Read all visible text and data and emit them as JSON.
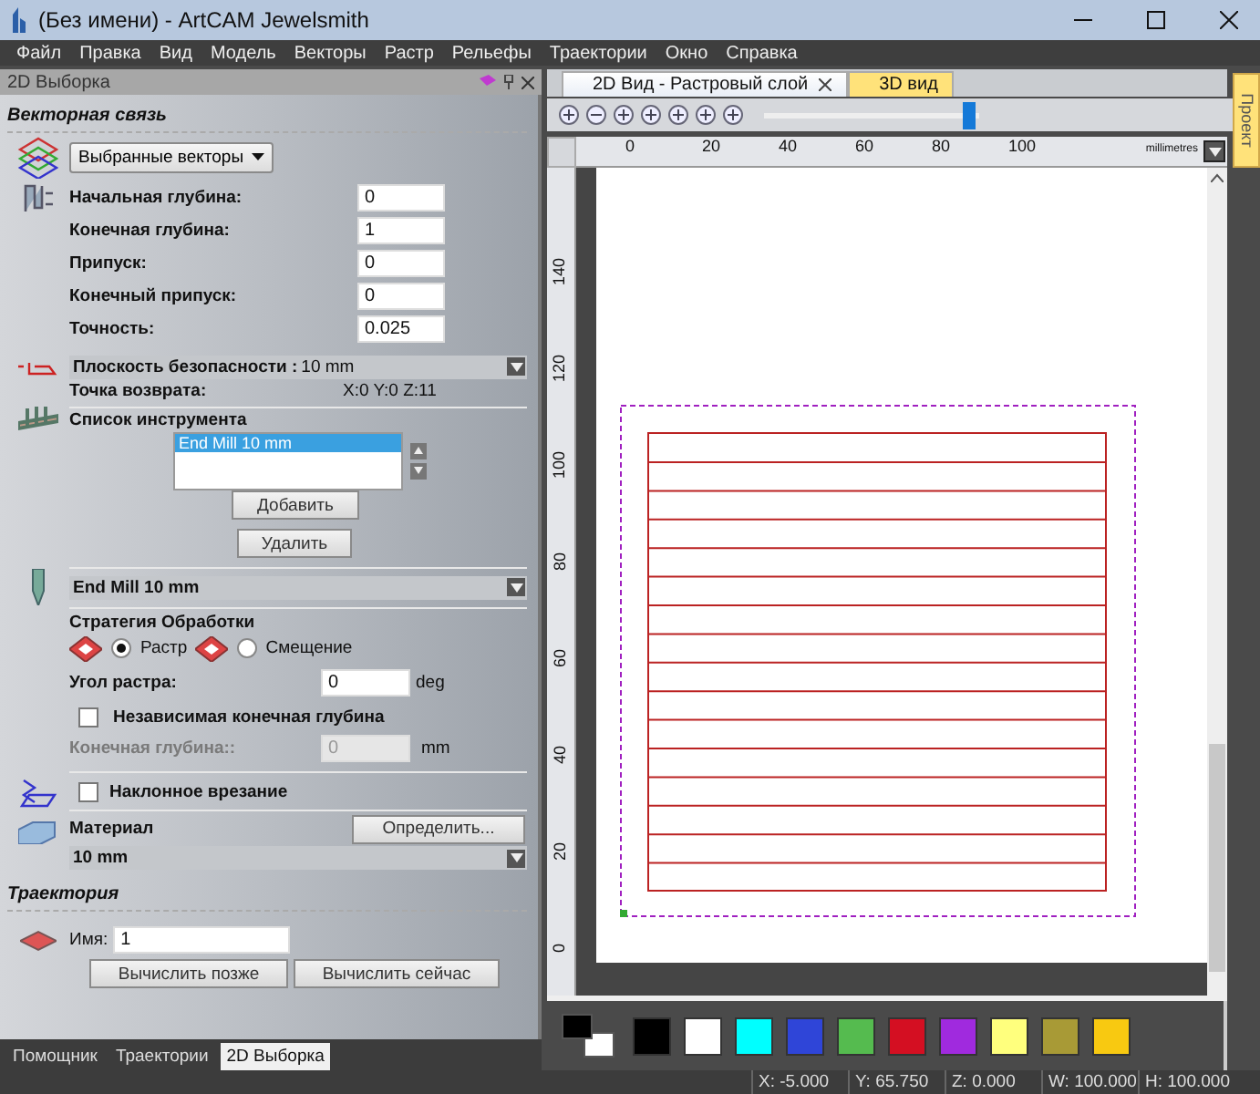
{
  "window": {
    "title": "(Без имени) - ArtCAM Jewelsmith"
  },
  "menu": [
    "Файл",
    "Правка",
    "Вид",
    "Модель",
    "Векторы",
    "Растр",
    "Рельефы",
    "Траектории",
    "Окно",
    "Справка"
  ],
  "panel": {
    "title": "2D Выборка",
    "vector_section": {
      "heading": "Векторная связь",
      "selection": "Выбранные векторы"
    },
    "depth_fields": [
      {
        "label": "Начальная глубина:",
        "value": "0"
      },
      {
        "label": "Конечная глубина:",
        "value": "1"
      },
      {
        "label": "Припуск:",
        "value": "0"
      },
      {
        "label": "Конечный припуск:",
        "value": "0"
      },
      {
        "label": "Точность:",
        "value": "0.025"
      }
    ],
    "safety": {
      "label": "Плоскость безопасности :",
      "value": "10 mm"
    },
    "return_point": {
      "label": "Точка возврата:",
      "value": "X:0 Y:0 Z:11"
    },
    "tool_list": {
      "heading": "Список инструмента",
      "items": [
        {
          "label": "End Mill 10 mm",
          "selected": true
        }
      ],
      "add": "Добавить",
      "remove": "Удалить"
    },
    "tool": "End Mill 10 mm",
    "strategy": {
      "heading": "Стратегия Обработки",
      "options": [
        {
          "label": "Растр",
          "selected": true
        },
        {
          "label": "Смещение",
          "selected": false
        }
      ]
    },
    "raster_angle": {
      "label": "Угол растра:",
      "value": "0",
      "unit": "deg"
    },
    "independent_depth": {
      "label": "Независимая конечная глубина",
      "checked": false
    },
    "final_depth": {
      "label": "Конечная глубина::",
      "value": "0",
      "unit": "mm",
      "disabled": true
    },
    "ramp": {
      "label": "Наклонное врезание",
      "checked": false
    },
    "material": {
      "label": "Материал",
      "button": "Определить...",
      "value": "10 mm"
    },
    "toolpath": {
      "heading": "Траектория",
      "name_label": "Имя:",
      "name": "1",
      "buttons": [
        "Вычислить позже",
        "Вычислить сейчас"
      ]
    }
  },
  "panel_tabs": [
    {
      "label": "Помощник",
      "selected": false
    },
    {
      "label": "Траектории",
      "selected": false
    },
    {
      "label": "2D Выборка",
      "selected": true
    }
  ],
  "view_tabs": [
    {
      "label": "2D Вид - Растровый слой",
      "selected": true
    },
    {
      "label": "3D вид",
      "selected": false
    }
  ],
  "zoom": {
    "level": 0.95
  },
  "ruler": {
    "x_labels": [
      "0",
      "20",
      "40",
      "60",
      "80",
      "100"
    ],
    "units": "millimetres",
    "y_labels": [
      "140",
      "120",
      "100",
      "80",
      "60",
      "40",
      "20",
      "0"
    ]
  },
  "side_tab": "Проект",
  "palette": [
    {
      "color": "#000000"
    },
    {
      "color": "#ffffff"
    },
    {
      "color": "#00ffff"
    },
    {
      "color": "#2f45d8"
    },
    {
      "color": "#55bb4f"
    },
    {
      "color": "#d40f22"
    },
    {
      "color": "#a02ade"
    },
    {
      "color": "#ffff7d"
    },
    {
      "color": "#a89a36"
    },
    {
      "color": "#f8c911"
    }
  ],
  "status": [
    "X: -5.000",
    "Y: 65.750",
    "Z: 0.000",
    "W: 100.000",
    "H: 100.000"
  ]
}
